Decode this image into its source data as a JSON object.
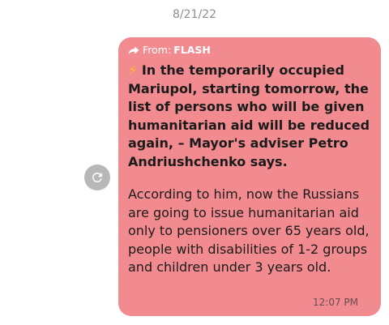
{
  "conversation": {
    "date": "8/21/22"
  },
  "message": {
    "forwarded_prefix": "From:",
    "forwarded_source": "FLASH",
    "headline_emoji": "⚡",
    "headline": "In the temporarily occupied Mariupol, starting tomorrow, the list of persons who will be given humanitarian aid will be reduced again, – Mayor's adviser Petro Andriushchenko says.",
    "body": "According to him, now the Russians are going to issue humanitarian aid only to pensioners over 65 years old, people with disabilities of 1-2 groups and children under 3 years old.",
    "time": "12:07 PM",
    "bubble_color": "#f28b8f"
  },
  "icons": {
    "forward_arrow": "forward-arrow-icon",
    "resend": "refresh-icon"
  }
}
